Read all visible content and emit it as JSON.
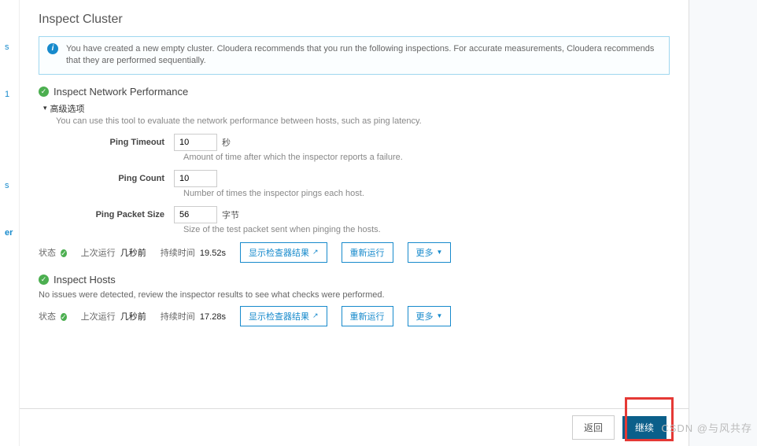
{
  "page_title": "Inspect Cluster",
  "info_box": {
    "text": "You have created a new empty cluster. Cloudera recommends that you run the following inspections. For accurate measurements, Cloudera recommends that they are performed sequentially."
  },
  "left_rail": {
    "items": [
      "s",
      "1",
      "s",
      "er"
    ]
  },
  "network": {
    "title": "Inspect Network Performance",
    "advanced_label": "高级选项",
    "advanced_desc": "You can use this tool to evaluate the network performance between hosts, such as ping latency.",
    "ping_timeout": {
      "label": "Ping Timeout",
      "value": "10",
      "unit": "秒",
      "help": "Amount of time after which the inspector reports a failure."
    },
    "ping_count": {
      "label": "Ping Count",
      "value": "10",
      "help": "Number of times the inspector pings each host."
    },
    "ping_packet": {
      "label": "Ping Packet Size",
      "value": "56",
      "unit": "字节",
      "help": "Size of the test packet sent when pinging the hosts."
    },
    "status": {
      "status_label": "状态",
      "last_run_label": "上次运行",
      "last_run_value": "几秒前",
      "duration_label": "持续时间",
      "duration_value": "19.52s",
      "btn_results": "显示检查器结果",
      "btn_rerun": "重新运行",
      "btn_more": "更多"
    }
  },
  "hosts": {
    "title": "Inspect Hosts",
    "desc": "No issues were detected, review the inspector results to see what checks were performed.",
    "status": {
      "status_label": "状态",
      "last_run_label": "上次运行",
      "last_run_value": "几秒前",
      "duration_label": "持续时间",
      "duration_value": "17.28s",
      "btn_results": "显示检查器结果",
      "btn_rerun": "重新运行",
      "btn_more": "更多"
    }
  },
  "footer": {
    "back": "返回",
    "continue": "继续"
  },
  "watermark": "CSDN @与风共存"
}
